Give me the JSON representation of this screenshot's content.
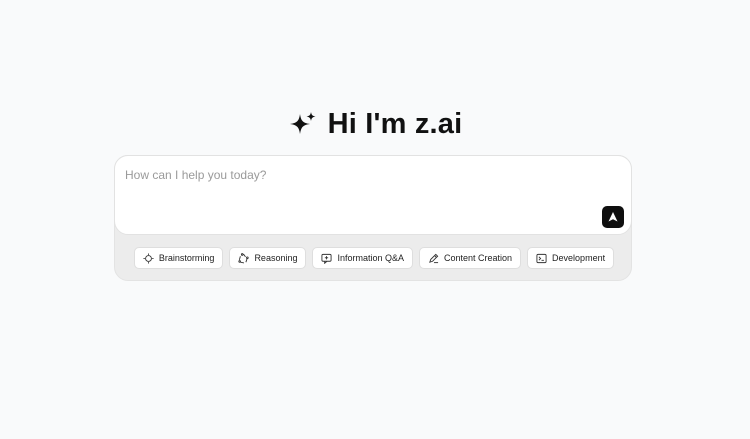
{
  "greeting": {
    "icon": "sparkle-icon",
    "text": "Hi I'm z.ai"
  },
  "composer": {
    "placeholder": "How can I help you today?",
    "value": "",
    "send_icon": "send-arrow-icon"
  },
  "chips": [
    {
      "label": "Brainstorming",
      "icon": "bulb-icon"
    },
    {
      "label": "Reasoning",
      "icon": "reasoning-icon"
    },
    {
      "label": "Information Q&A",
      "icon": "qa-icon"
    },
    {
      "label": "Content Creation",
      "icon": "pen-icon"
    },
    {
      "label": "Development",
      "icon": "terminal-icon"
    }
  ],
  "colors": {
    "background": "#f9fafb",
    "send_button": "#0f0f0f",
    "chip_tray": "#ececec"
  }
}
